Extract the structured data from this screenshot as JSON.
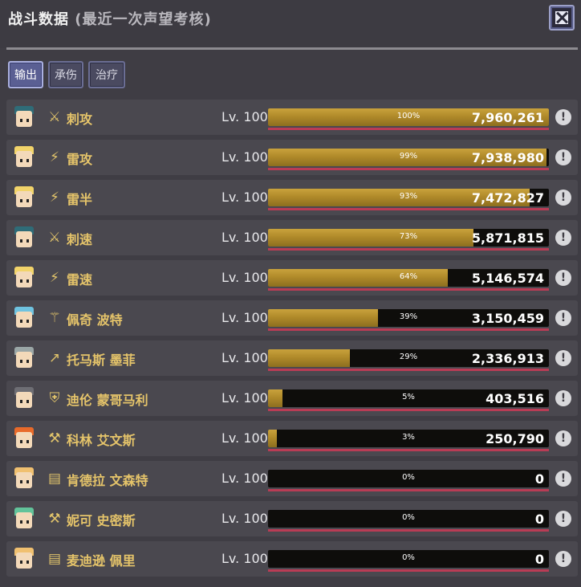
{
  "header": {
    "title": "战斗数据",
    "subtitle": "(最近一次声望考核)"
  },
  "tabs": [
    {
      "label": "输出",
      "active": true
    },
    {
      "label": "承伤",
      "active": false
    },
    {
      "label": "治疗",
      "active": false
    }
  ],
  "rows": [
    {
      "name": "刺攻",
      "level": "Lv. 100",
      "percent": "100%",
      "fraction": 1.0,
      "value": "7,960,261",
      "class_icon": "crossed-swords-icon",
      "hair": "#2f6c78"
    },
    {
      "name": "雷攻",
      "level": "Lv. 100",
      "percent": "99%",
      "fraction": 0.99,
      "value": "7,938,980",
      "class_icon": "lightning-staff-icon",
      "hair": "#f2d46a"
    },
    {
      "name": "雷半",
      "level": "Lv. 100",
      "percent": "93%",
      "fraction": 0.93,
      "value": "7,472,827",
      "class_icon": "lightning-staff-icon",
      "hair": "#f2d46a"
    },
    {
      "name": "刺速",
      "level": "Lv. 100",
      "percent": "73%",
      "fraction": 0.73,
      "value": "5,871,815",
      "class_icon": "crossed-swords-icon",
      "hair": "#2f6c78"
    },
    {
      "name": "雷速",
      "level": "Lv. 100",
      "percent": "64%",
      "fraction": 0.64,
      "value": "5,146,574",
      "class_icon": "lightning-staff-icon",
      "hair": "#f2d46a"
    },
    {
      "name": "佩奇 波特",
      "level": "Lv. 100",
      "percent": "39%",
      "fraction": 0.39,
      "value": "3,150,459",
      "class_icon": "staff-icon",
      "hair": "#6fc3e0"
    },
    {
      "name": "托马斯 墨菲",
      "level": "Lv. 100",
      "percent": "29%",
      "fraction": 0.29,
      "value": "2,336,913",
      "class_icon": "spear-icon",
      "hair": "#9aa6a6"
    },
    {
      "name": "迪伦 蒙哥马利",
      "level": "Lv. 100",
      "percent": "5%",
      "fraction": 0.05,
      "value": "403,516",
      "class_icon": "shield-icon",
      "hair": "#6e6e74"
    },
    {
      "name": "科林 艾文斯",
      "level": "Lv. 100",
      "percent": "3%",
      "fraction": 0.03,
      "value": "250,790",
      "class_icon": "hammer-icon",
      "hair": "#e86a2a"
    },
    {
      "name": "肯德拉 文森特",
      "level": "Lv. 100",
      "percent": "0%",
      "fraction": 0.0,
      "value": "0",
      "class_icon": "book-icon",
      "hair": "#f0c070"
    },
    {
      "name": "妮可 史密斯",
      "level": "Lv. 100",
      "percent": "0%",
      "fraction": 0.0,
      "value": "0",
      "class_icon": "axe-icon",
      "hair": "#62c39a"
    },
    {
      "name": "麦迪逊 佩里",
      "level": "Lv. 100",
      "percent": "0%",
      "fraction": 0.0,
      "value": "0",
      "class_icon": "book-icon",
      "hair": "#f0c070"
    }
  ],
  "colors": {
    "bar_fill": "#b08a2a",
    "name_gold": "#e5c46a",
    "row_bg": "#4a484f",
    "accent_line": "#b93c55"
  }
}
